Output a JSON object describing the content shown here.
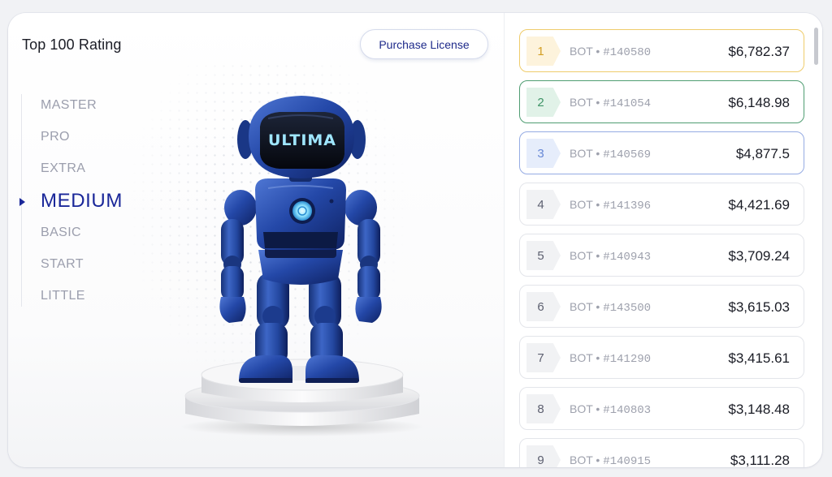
{
  "header": {
    "title": "Top 100 Rating",
    "purchase_label": "Purchase License"
  },
  "tiers": [
    "MASTER",
    "PRO",
    "EXTRA",
    "MEDIUM",
    "BASIC",
    "START",
    "LITTLE"
  ],
  "active_tier": "MEDIUM",
  "robot": {
    "visor_text": "ULTIMA"
  },
  "bot_prefix": "BOT • ",
  "rankings": [
    {
      "rank": "1",
      "bot": "#140580",
      "price": "$6,782.37",
      "style": "gold"
    },
    {
      "rank": "2",
      "bot": "#141054",
      "price": "$6,148.98",
      "style": "green"
    },
    {
      "rank": "3",
      "bot": "#140569",
      "price": "$4,877.5",
      "style": "blue"
    },
    {
      "rank": "4",
      "bot": "#141396",
      "price": "$4,421.69",
      "style": "plain"
    },
    {
      "rank": "5",
      "bot": "#140943",
      "price": "$3,709.24",
      "style": "plain"
    },
    {
      "rank": "6",
      "bot": "#143500",
      "price": "$3,615.03",
      "style": "plain"
    },
    {
      "rank": "7",
      "bot": "#141290",
      "price": "$3,415.61",
      "style": "plain"
    },
    {
      "rank": "8",
      "bot": "#140803",
      "price": "$3,148.48",
      "style": "plain"
    },
    {
      "rank": "9",
      "bot": "#140915",
      "price": "$3,111.28",
      "style": "plain"
    }
  ],
  "colors": {
    "accent": "#1a2799",
    "gold": "#d39f24",
    "green": "#3f9467",
    "blue": "#6788d6",
    "robot_body": "#2448a8"
  }
}
